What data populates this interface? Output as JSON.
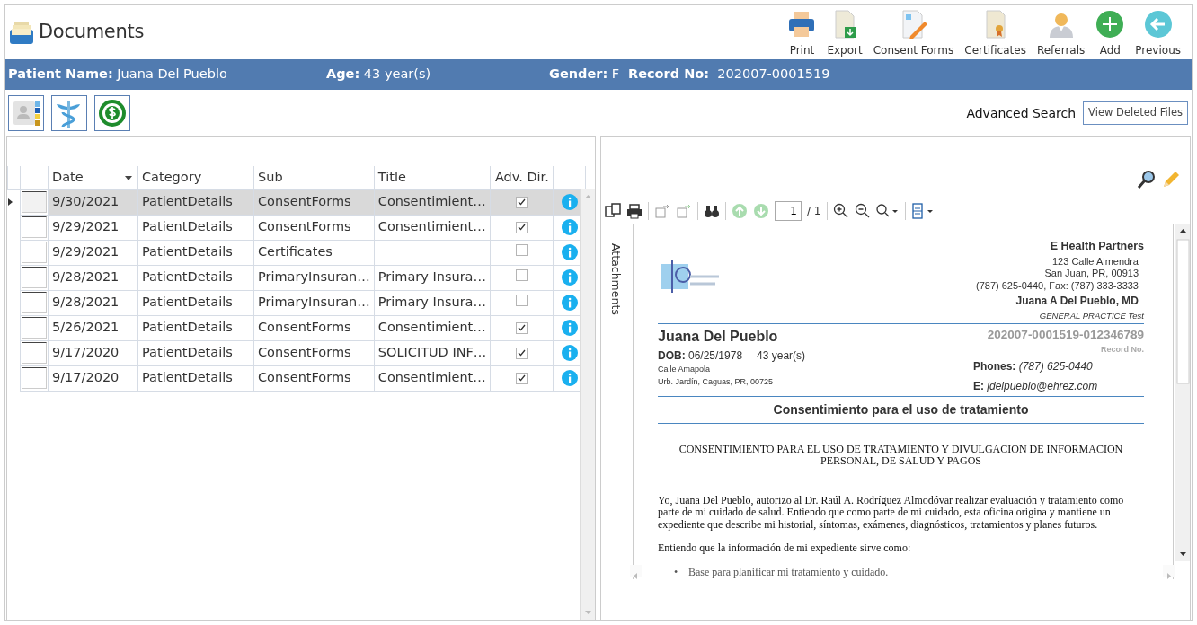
{
  "window": {
    "title": "Documents"
  },
  "toolbar": [
    {
      "label": "Print"
    },
    {
      "label": "Export"
    },
    {
      "label": "Consent Forms"
    },
    {
      "label": "Certificates"
    },
    {
      "label": "Referrals"
    },
    {
      "label": "Add"
    },
    {
      "label": "Previous"
    }
  ],
  "patient_bar": [
    {
      "label": "Patient Name:",
      "value": "Juana Del Pueblo"
    },
    {
      "label": "Age:",
      "value": "43 year(s)"
    },
    {
      "label": "Gender:",
      "value": "F"
    },
    {
      "label": "Record No:",
      "value": "202007-0001519"
    }
  ],
  "links": {
    "advanced_search": "Advanced Search",
    "view_deleted": "View Deleted Files"
  },
  "table": {
    "columns": [
      "Date",
      "Category",
      "Sub",
      "Title",
      "Adv. Dir."
    ],
    "rows": [
      {
        "date": "9/30/2021",
        "category": "PatientDetails",
        "sub": "ConsentForms",
        "title": "Consentimient…",
        "adv_dir": true,
        "selected": true
      },
      {
        "date": "9/29/2021",
        "category": "PatientDetails",
        "sub": "ConsentForms",
        "title": "Consentimient…",
        "adv_dir": true,
        "selected": false
      },
      {
        "date": "9/29/2021",
        "category": "PatientDetails",
        "sub": "Certificates",
        "title": "",
        "adv_dir": false,
        "selected": false
      },
      {
        "date": "9/28/2021",
        "category": "PatientDetails",
        "sub": "PrimaryInsuran…",
        "title": "Primary Insura…",
        "adv_dir": false,
        "selected": false
      },
      {
        "date": "9/28/2021",
        "category": "PatientDetails",
        "sub": "PrimaryInsuran…",
        "title": "Primary Insura…",
        "adv_dir": false,
        "selected": false
      },
      {
        "date": "5/26/2021",
        "category": "PatientDetails",
        "sub": "ConsentForms",
        "title": "Consentimient…",
        "adv_dir": true,
        "selected": false
      },
      {
        "date": "9/17/2020",
        "category": "PatientDetails",
        "sub": "ConsentForms",
        "title": "SOLICITUD INF…",
        "adv_dir": true,
        "selected": false
      },
      {
        "date": "9/17/2020",
        "category": "PatientDetails",
        "sub": "ConsentForms",
        "title": "Consentimient…",
        "adv_dir": true,
        "selected": false
      }
    ]
  },
  "viewer": {
    "page_value": "1",
    "page_total": "/ 1",
    "side_tab": "Attachments",
    "document": {
      "practice": "E Health Partners",
      "address": [
        "123 Calle Almendra",
        "San Juan, PR, 00913",
        "(787) 625-0440, Fax: (787) 333-3333"
      ],
      "doctor": "Juana A Del Pueblo, MD",
      "specialty": "GENERAL PRACTICE Test",
      "patient": "Juana Del Pueblo",
      "record": "202007-0001519-012346789",
      "record_label": "Record No.",
      "dob": "**DOB:** 06/25/1978",
      "age": "43 year(s)",
      "street": [
        "Calle Amapola",
        "Urb. Jardín, Caguas, PR, 00725"
      ],
      "phones": "**Phones:** *(787) 625-0440*",
      "email": "**E:** *jdelpueblo@ehrez.com*",
      "heading": "Consentimiento para el uso de tratamiento",
      "subheading": "CONSENTIMIENTO PARA EL USO DE TRATAMIENTO Y DIVULGACION DE INFORMACION PERSONAL, DE SALUD Y PAGOS",
      "paragraphs": [
        "Yo, Juana Del Pueblo, autorizo al Dr. Raúl A. Rodríguez Almodóvar realizar evaluación y tratamiento como parte de mi cuidado de salud.  Entiendo que como parte de mi cuidado, esta oficina origina y mantiene un expediente que describe mi historial, síntomas, exámenes, diagnósticos, tratamientos y planes futuros.",
        "Entiendo que la información de mi expediente sirve como:"
      ],
      "bullets": [
        {
          "marker": "•",
          "text": "Base para planificar mi tratamiento y cuidado."
        }
      ]
    }
  }
}
